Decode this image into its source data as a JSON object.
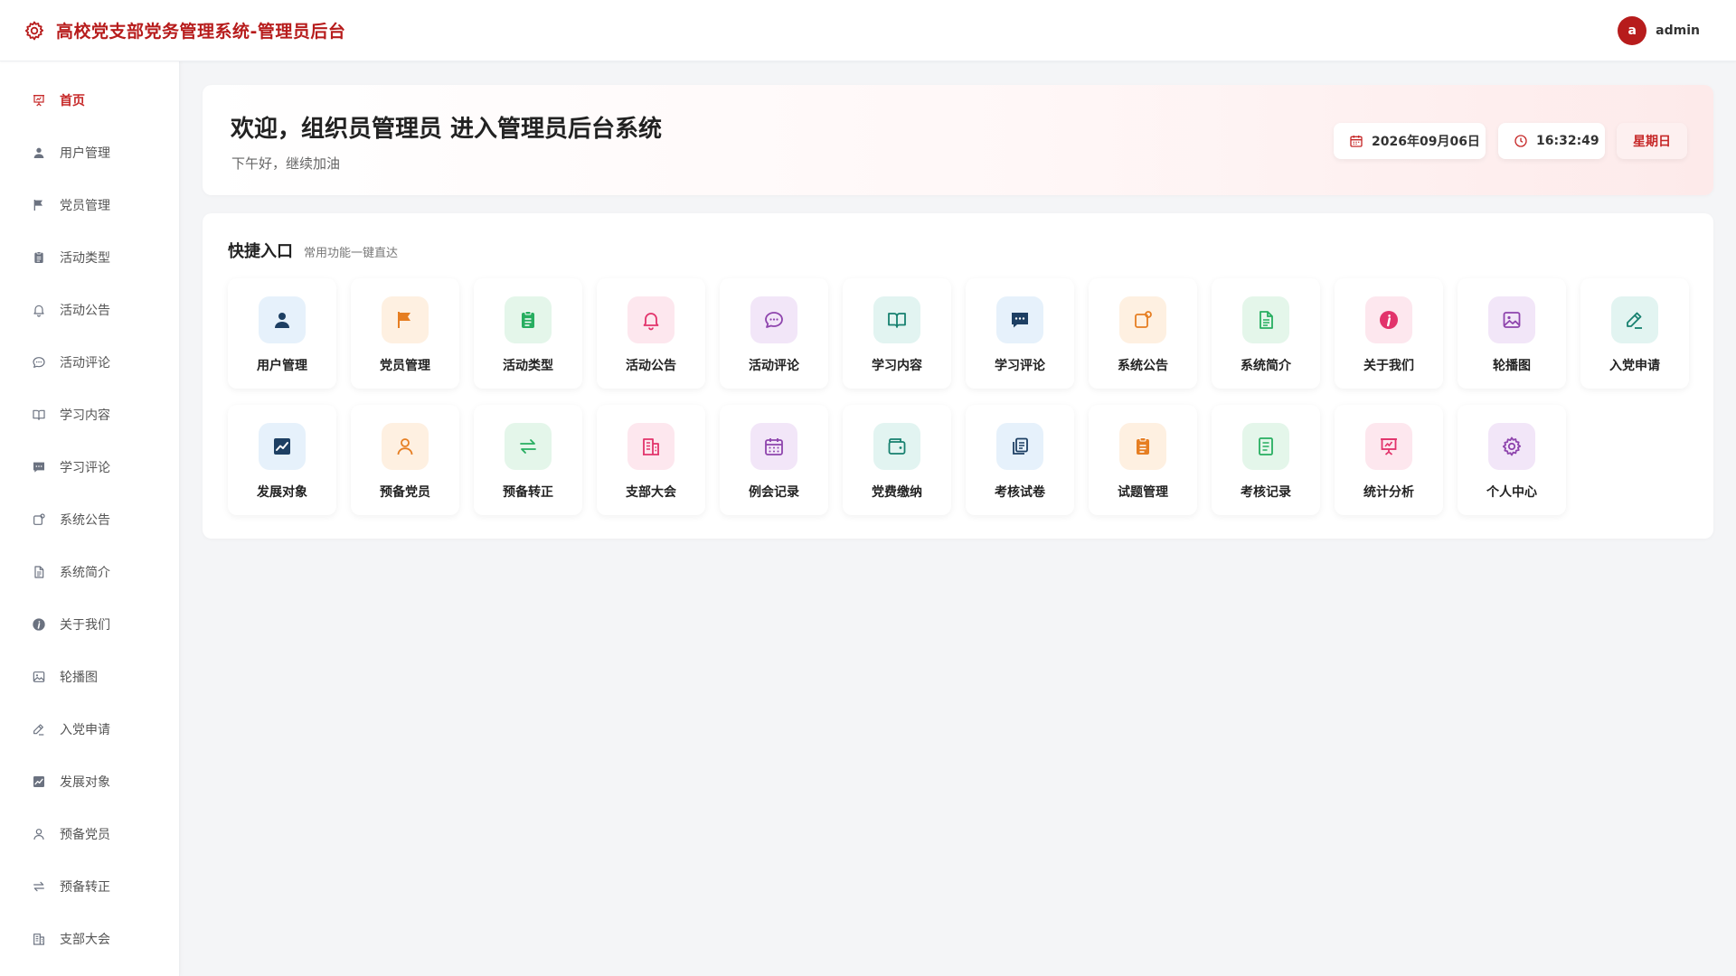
{
  "header": {
    "title": "高校党支部党务管理系统-管理员后台",
    "avatar_letter": "a",
    "username": "admin",
    "brand_color": "#b71c1c",
    "logo_icon": "gear-icon"
  },
  "sidebar": {
    "items": [
      {
        "label": "首页",
        "icon": "presentation-icon",
        "active": true
      },
      {
        "label": "用户管理",
        "icon": "user-icon"
      },
      {
        "label": "党员管理",
        "icon": "flag-icon"
      },
      {
        "label": "活动类型",
        "icon": "clipboard-icon"
      },
      {
        "label": "活动公告",
        "icon": "bell-icon"
      },
      {
        "label": "活动评论",
        "icon": "chat-bubble-icon"
      },
      {
        "label": "学习内容",
        "icon": "book-icon"
      },
      {
        "label": "学习评论",
        "icon": "comment-icon"
      },
      {
        "label": "系统公告",
        "icon": "notice-icon"
      },
      {
        "label": "系统简介",
        "icon": "document-icon"
      },
      {
        "label": "关于我们",
        "icon": "info-icon"
      },
      {
        "label": "轮播图",
        "icon": "image-icon"
      },
      {
        "label": "入党申请",
        "icon": "pen-icon"
      },
      {
        "label": "发展对象",
        "icon": "chart-icon"
      },
      {
        "label": "预备党员",
        "icon": "person-outline-icon"
      },
      {
        "label": "预备转正",
        "icon": "swap-icon"
      },
      {
        "label": "支部大会",
        "icon": "building-icon"
      }
    ]
  },
  "welcome": {
    "title": "欢迎，组织员管理员 进入管理员后台系统",
    "subtitle": "下午好，继续加油",
    "date": "2026年09月06日",
    "time": "16:32:49",
    "weekday": "星期日"
  },
  "quick": {
    "title": "快捷入口",
    "subtitle": "常用功能一键直达",
    "tiles": [
      {
        "label": "用户管理",
        "icon": "user-icon",
        "color": "#1d3f63",
        "bg": "#e6f1fb"
      },
      {
        "label": "党员管理",
        "icon": "flag-icon",
        "color": "#e67e22",
        "bg": "#fef0e1"
      },
      {
        "label": "活动类型",
        "icon": "clipboard-icon",
        "color": "#27ae60",
        "bg": "#e4f6ea"
      },
      {
        "label": "活动公告",
        "icon": "bell-icon",
        "color": "#e2336b",
        "bg": "#fde7ee"
      },
      {
        "label": "活动评论",
        "icon": "chat-bubble-icon",
        "color": "#8e44ad",
        "bg": "#f2e6f8"
      },
      {
        "label": "学习内容",
        "icon": "book-icon",
        "color": "#16806f",
        "bg": "#e2f4f1"
      },
      {
        "label": "学习评论",
        "icon": "comment-icon",
        "color": "#1d3f63",
        "bg": "#e6f1fb"
      },
      {
        "label": "系统公告",
        "icon": "notice-icon",
        "color": "#e67e22",
        "bg": "#fef0e1"
      },
      {
        "label": "系统简介",
        "icon": "document-icon",
        "color": "#27ae60",
        "bg": "#e4f6ea"
      },
      {
        "label": "关于我们",
        "icon": "info-icon",
        "color": "#e2336b",
        "bg": "#fde7ee"
      },
      {
        "label": "轮播图",
        "icon": "image-icon",
        "color": "#8e44ad",
        "bg": "#f2e6f8"
      },
      {
        "label": "入党申请",
        "icon": "pen-icon",
        "color": "#16806f",
        "bg": "#e2f4f1"
      },
      {
        "label": "发展对象",
        "icon": "chart-icon",
        "color": "#1d3f63",
        "bg": "#e6f1fb"
      },
      {
        "label": "预备党员",
        "icon": "person-outline-icon",
        "color": "#e67e22",
        "bg": "#fef0e1"
      },
      {
        "label": "预备转正",
        "icon": "swap-icon",
        "color": "#27ae60",
        "bg": "#e4f6ea"
      },
      {
        "label": "支部大会",
        "icon": "building-icon",
        "color": "#e2336b",
        "bg": "#fde7ee"
      },
      {
        "label": "例会记录",
        "icon": "calendar-icon",
        "color": "#8e44ad",
        "bg": "#f2e6f8"
      },
      {
        "label": "党费缴纳",
        "icon": "wallet-icon",
        "color": "#16806f",
        "bg": "#e2f4f1"
      },
      {
        "label": "考核试卷",
        "icon": "copy-icon",
        "color": "#1d3f63",
        "bg": "#e6f1fb"
      },
      {
        "label": "试题管理",
        "icon": "clipboard-icon",
        "color": "#e67e22",
        "bg": "#fef0e1"
      },
      {
        "label": "考核记录",
        "icon": "record-icon",
        "color": "#27ae60",
        "bg": "#e4f6ea"
      },
      {
        "label": "统计分析",
        "icon": "presentation-icon",
        "color": "#e2336b",
        "bg": "#fde7ee"
      },
      {
        "label": "个人中心",
        "icon": "gear-icon",
        "color": "#8e44ad",
        "bg": "#f2e6f8"
      }
    ]
  }
}
